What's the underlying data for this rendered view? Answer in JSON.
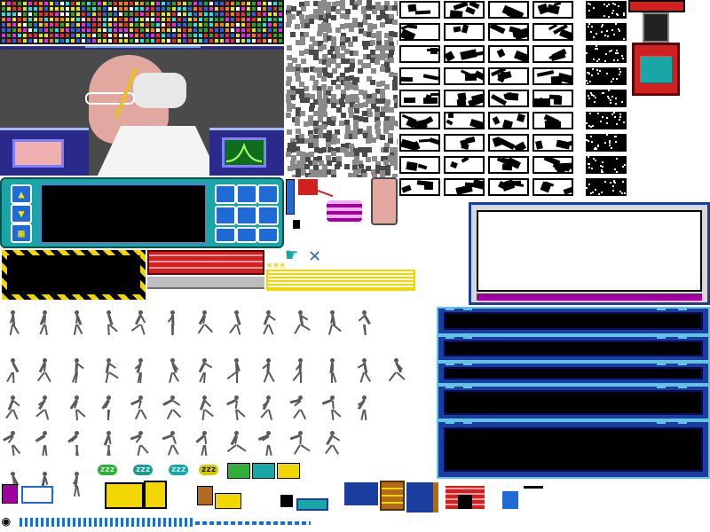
{
  "sheet": {
    "palette": {
      "bg": "#ffffff",
      "teal": "#18a6a6",
      "blue": "#1e6bd6",
      "magenta": "#a000a0",
      "yellow": "#f2d600",
      "red": "#d02020",
      "grey": "#5a5a5a",
      "black": "#000000"
    },
    "status_label": "***",
    "icons": {
      "up": "▲",
      "down": "▼",
      "grid": "▦",
      "pointer": "☛",
      "close": "✕",
      "coin": "◉"
    },
    "zzz_labels": [
      "zzz",
      "zzz",
      "zzz",
      "zzz"
    ],
    "sprite_groups": {
      "portrait": "scientist-portrait",
      "control_panel": "control-panel",
      "tileset": "maze-tiles",
      "starfield": "starfield-tiles",
      "vehicle": "vehicle",
      "runner_frames": "runner-frames",
      "status_panels": "status-panels",
      "furniture": "furniture-row"
    }
  }
}
